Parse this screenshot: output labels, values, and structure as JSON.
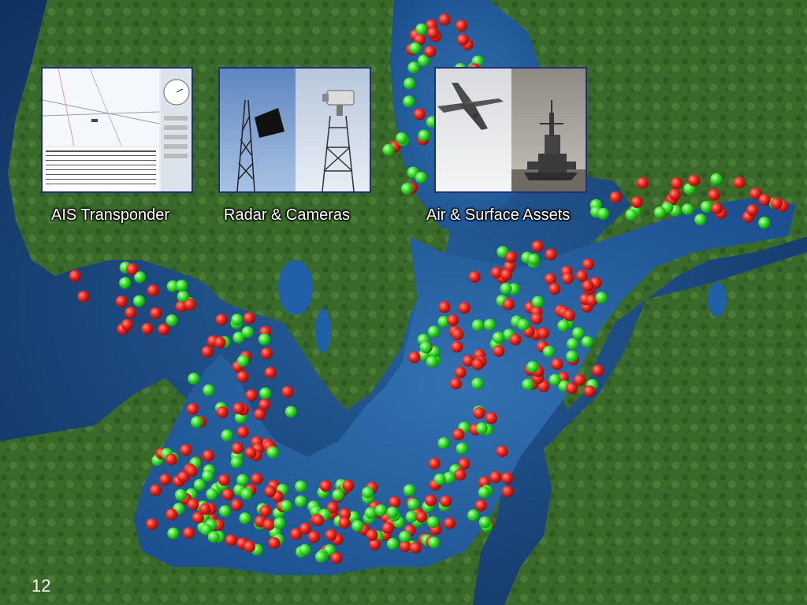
{
  "sources": [
    {
      "id": "ais",
      "label": "AIS Transponder"
    },
    {
      "id": "radar",
      "label": "Radar & Cameras"
    },
    {
      "id": "assets",
      "label": "Air & Surface Assets"
    }
  ],
  "page_number": "12",
  "colors": {
    "sea": "#1b4a8a",
    "land": "#3f6e2c",
    "vessel_red": "#e8261c",
    "vessel_green": "#36e02a"
  }
}
